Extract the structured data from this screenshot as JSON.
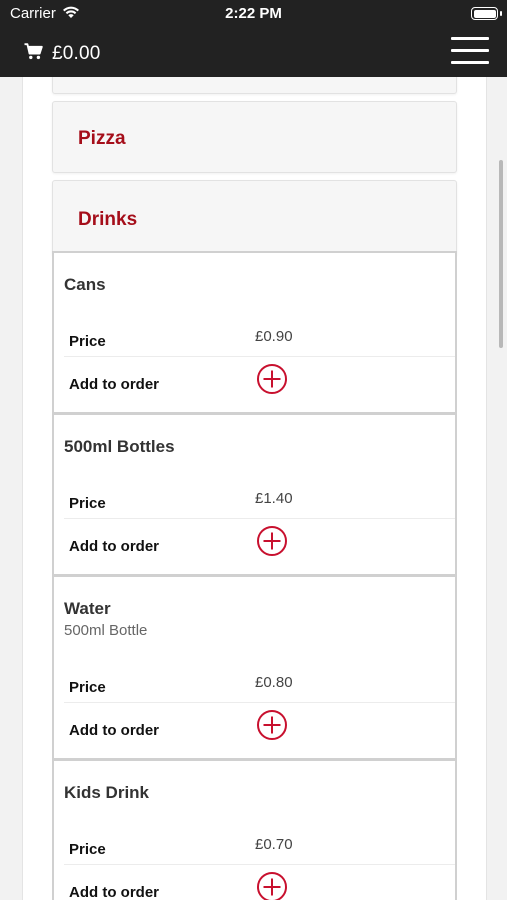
{
  "status_bar": {
    "carrier": "Carrier",
    "time": "2:22 PM"
  },
  "header": {
    "cart_total": "£0.00",
    "cart_icon": "shopping-cart-icon",
    "menu_icon": "hamburger-menu-icon"
  },
  "categories": [
    {
      "label": "Pizza"
    },
    {
      "label": "Drinks"
    }
  ],
  "colors": {
    "header_bg": "#222222",
    "category_title": "#a50e1a",
    "add_icon": "#c8102e"
  },
  "drinks": [
    {
      "name": "Cans",
      "description": "",
      "price_label": "Price",
      "price": "£0.90",
      "add_label": "Add to order"
    },
    {
      "name": "500ml Bottles",
      "description": "",
      "price_label": "Price",
      "price": "£1.40",
      "add_label": "Add to order"
    },
    {
      "name": "Water",
      "description": "500ml Bottle",
      "price_label": "Price",
      "price": "£0.80",
      "add_label": "Add to order"
    },
    {
      "name": "Kids Drink",
      "description": "",
      "price_label": "Price",
      "price": "£0.70",
      "add_label": "Add to order"
    }
  ]
}
